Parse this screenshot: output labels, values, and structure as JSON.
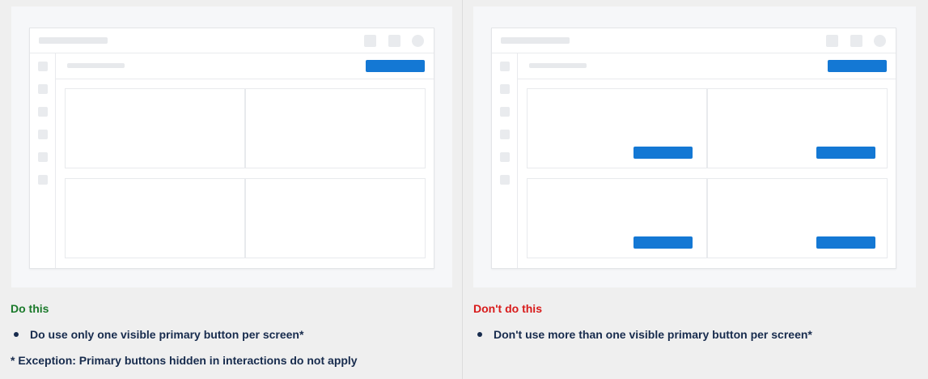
{
  "panels": [
    {
      "caption": "Do this",
      "caption_color": "#1b7a2b",
      "bullet": "Do use only one visible primary button per screen*",
      "footnote": "* Exception: Primary buttons hidden in interactions do not apply"
    },
    {
      "caption": "Don't do this",
      "caption_color": "#d81b1b",
      "bullet": "Don't use more than one visible primary button per screen*"
    }
  ],
  "colors": {
    "primary_button": "#1478d4",
    "text": "#172b4d"
  }
}
